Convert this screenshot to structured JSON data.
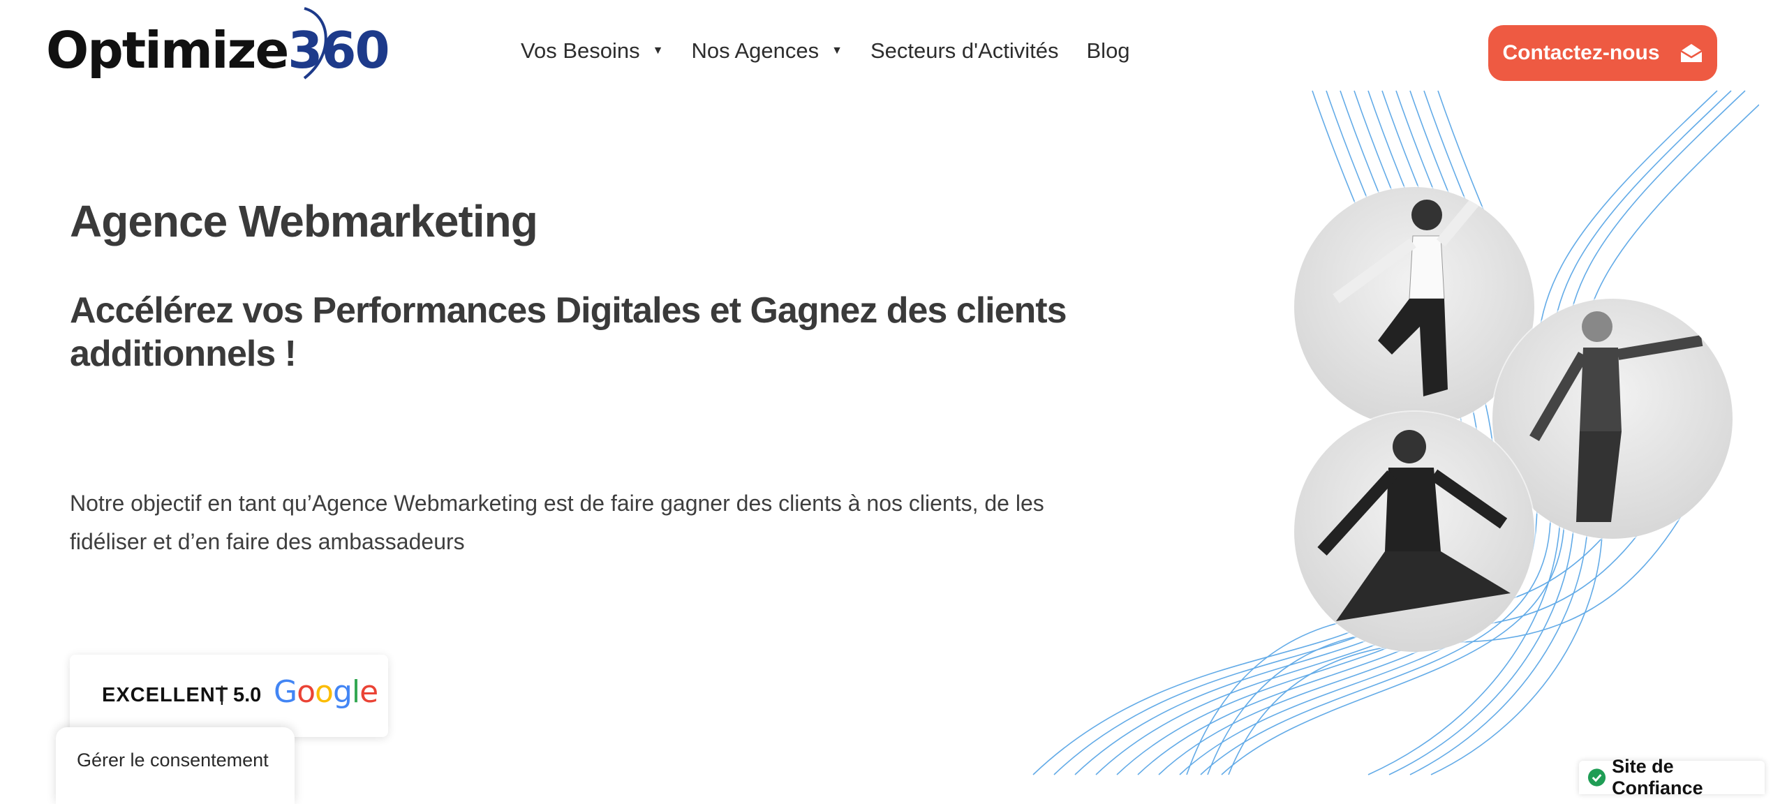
{
  "header": {
    "logo": {
      "word": "Optimize",
      "number": "360"
    },
    "nav": [
      {
        "label": "Vos Besoins",
        "has_dropdown": true
      },
      {
        "label": "Nos Agences",
        "has_dropdown": true
      },
      {
        "label": "Secteurs d'Activités",
        "has_dropdown": false
      },
      {
        "label": "Blog",
        "has_dropdown": false
      }
    ],
    "cta_label": "Contactez-nous"
  },
  "hero": {
    "title": "Agence Webmarketing",
    "subtitle": "Accélérez vos Performances Digitales et Gagnez des clients additionnels !",
    "description": "Notre objectif en tant qu’Agence Webmarketing est de faire gagner des clients à nos clients, de les fidéliser et d’en faire des ambassadeurs"
  },
  "rating": {
    "label": "EXCELLENT",
    "separator": "|",
    "score": "5.0",
    "provider": "Google"
  },
  "consent": {
    "label": "Gérer le consentement"
  },
  "trust_badge": {
    "label": "Site de Confiance"
  },
  "colors": {
    "accent": "#ee5a42",
    "logo_blue": "#1d3a8a",
    "wave_blue": "#2f8fe0",
    "trust_green": "#1f9d55"
  },
  "icons": [
    "chevron-down-icon",
    "envelope-open-icon",
    "google-logo",
    "check-circle-icon"
  ]
}
